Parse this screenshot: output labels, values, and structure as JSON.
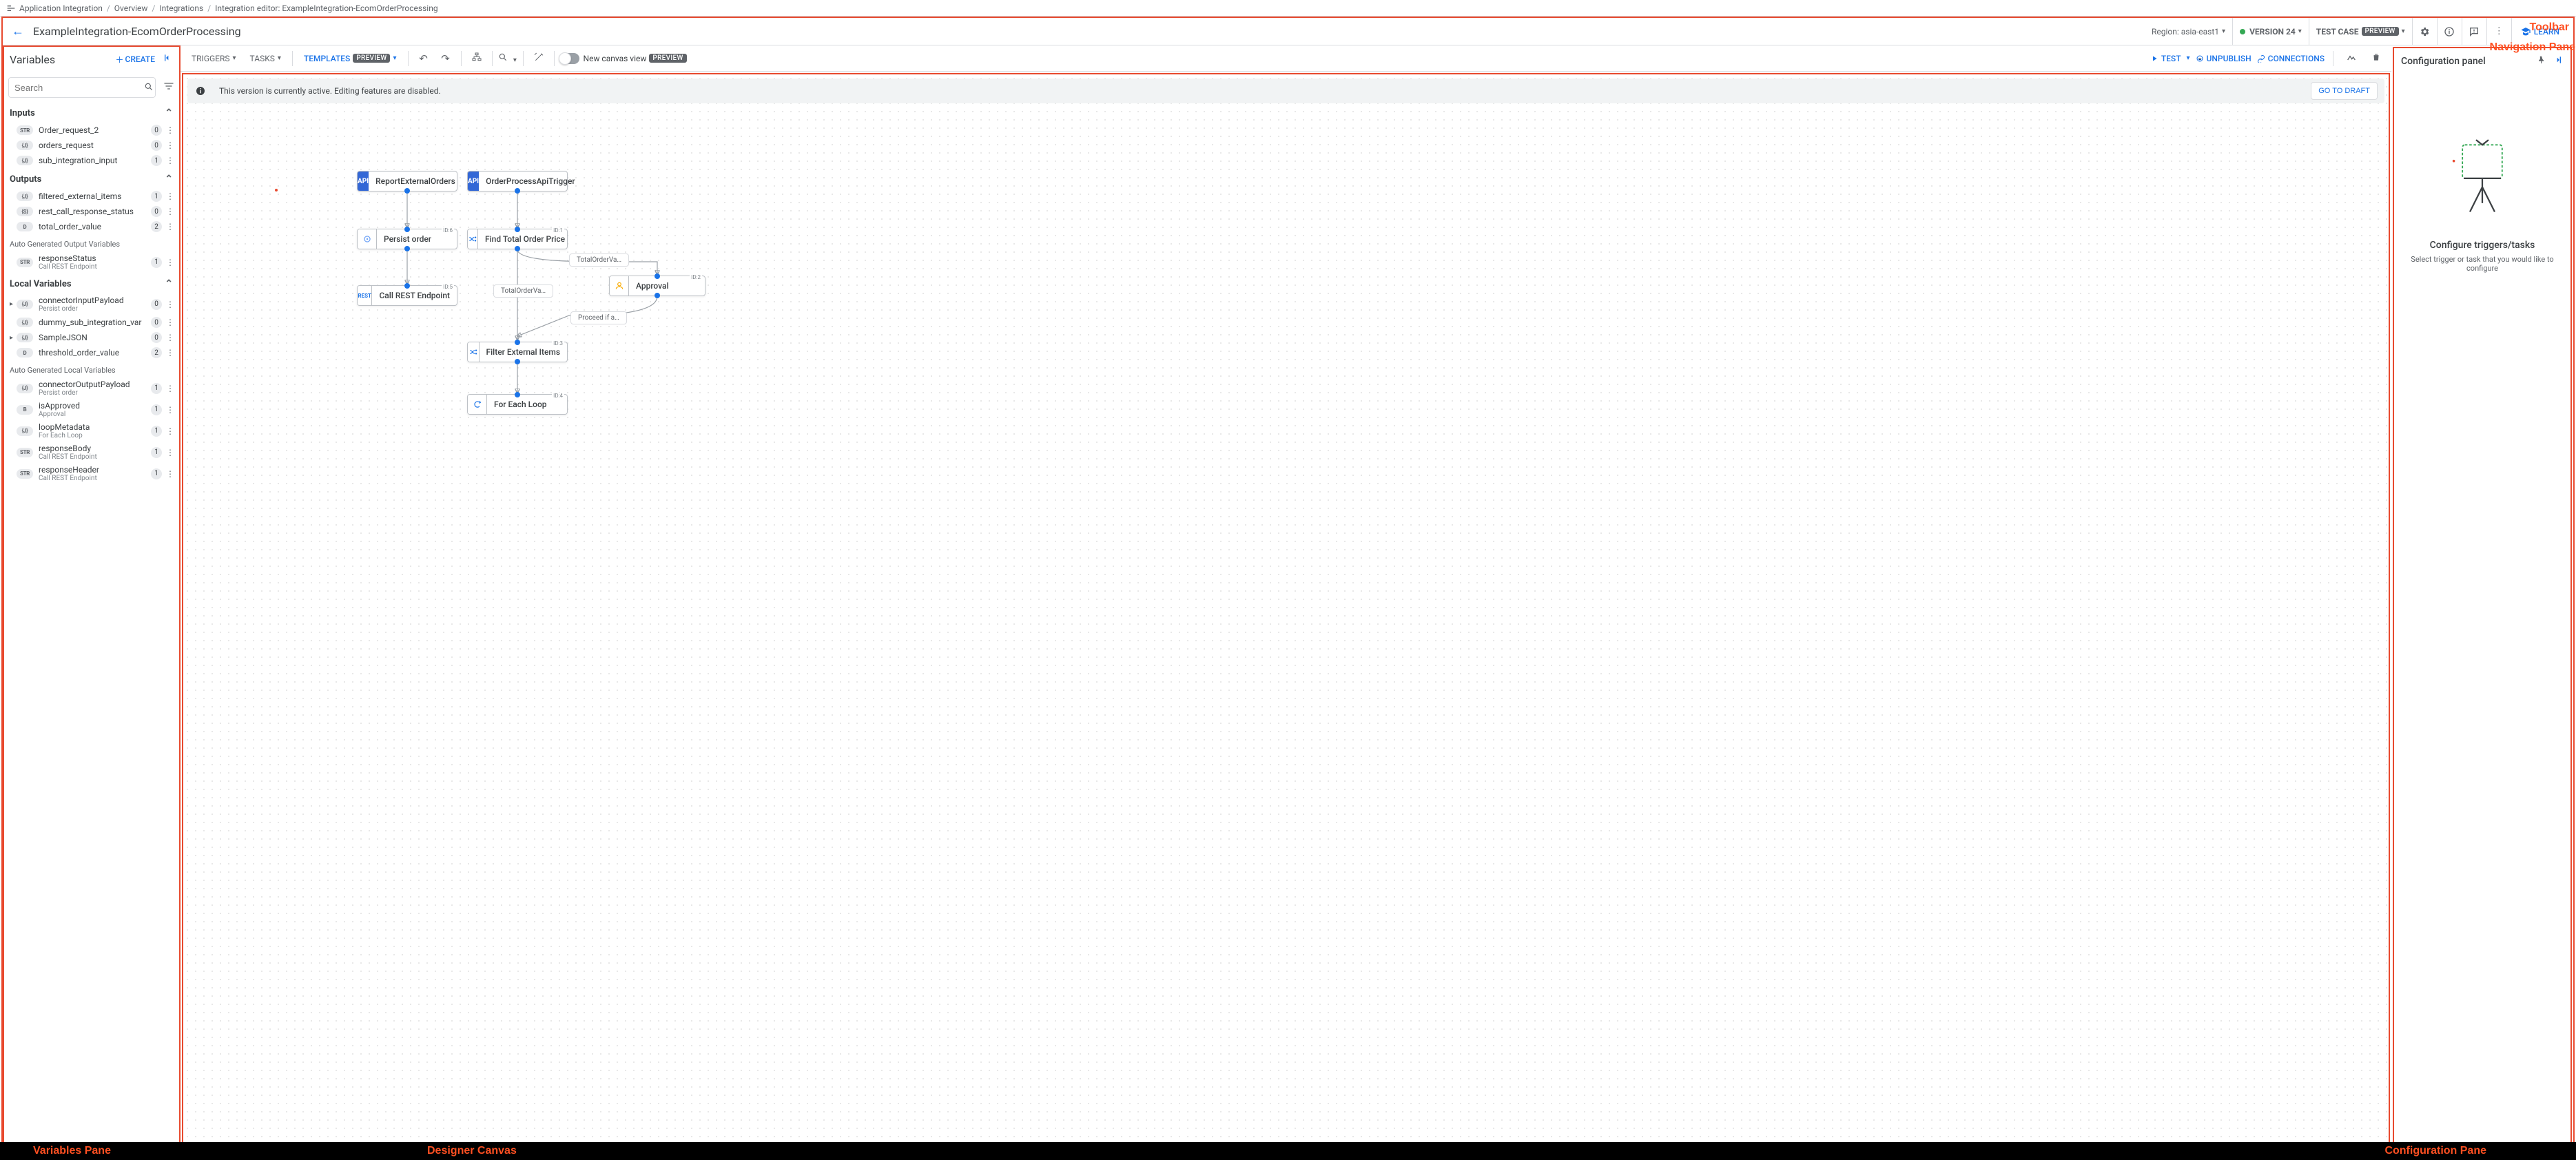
{
  "breadcrumb": {
    "items": [
      "Application Integration",
      "Overview",
      "Integrations",
      "Integration editor: ExampleIntegration-EcomOrderProcessing"
    ]
  },
  "titlebar": {
    "title": "ExampleIntegration-EcomOrderProcessing",
    "region_label": "Region:",
    "region_value": "asia-east1",
    "version_label": "VERSION 24",
    "testcase_label": "TEST CASE",
    "testcase_badge": "PREVIEW",
    "learn_label": "LEARN"
  },
  "variables_pane": {
    "title": "Variables",
    "create_label": "CREATE",
    "search_placeholder": "Search",
    "sections": {
      "inputs": {
        "label": "Inputs",
        "items": [
          {
            "type": "STR",
            "name": "Order_request_2",
            "count": "0"
          },
          {
            "type": "{J}",
            "name": "orders_request",
            "count": "0"
          },
          {
            "type": "{J}",
            "name": "sub_integration_input",
            "count": "1"
          }
        ]
      },
      "outputs": {
        "label": "Outputs",
        "items": [
          {
            "type": "{J}",
            "name": "filtered_external_items",
            "count": "1"
          },
          {
            "type": "{S}",
            "name": "rest_call_response_status",
            "count": "0"
          },
          {
            "type": "D",
            "name": "total_order_value",
            "count": "2"
          }
        ]
      },
      "auto_out": {
        "label": "Auto Generated Output Variables",
        "items": [
          {
            "type": "STR",
            "name": "responseStatus",
            "sub": "Call REST Endpoint",
            "count": "1"
          }
        ]
      },
      "local": {
        "label": "Local Variables",
        "items": [
          {
            "type": "{J}",
            "name": "connectorInputPayload",
            "sub": "Persist order",
            "count": "0",
            "expandable": true
          },
          {
            "type": "{J}",
            "name": "dummy_sub_integration_var",
            "count": "0"
          },
          {
            "type": "{J}",
            "name": "SampleJSON",
            "count": "0",
            "expandable": true
          },
          {
            "type": "D",
            "name": "threshold_order_value",
            "count": "2"
          }
        ]
      },
      "auto_local": {
        "label": "Auto Generated Local Variables",
        "items": [
          {
            "type": "{J}",
            "name": "connectorOutputPayload",
            "sub": "Persist order",
            "count": "1"
          },
          {
            "type": "B",
            "name": "isApproved",
            "sub": "Approval",
            "count": "1"
          },
          {
            "type": "{J}",
            "name": "loopMetadata",
            "sub": "For Each Loop",
            "count": "1"
          },
          {
            "type": "STR",
            "name": "responseBody",
            "sub": "Call REST Endpoint",
            "count": "1"
          },
          {
            "type": "STR",
            "name": "responseHeader",
            "sub": "Call REST Endpoint",
            "count": "1"
          }
        ]
      }
    }
  },
  "canvas_toolbar": {
    "triggers": "TRIGGERS",
    "tasks": "TASKS",
    "templates": "TEMPLATES",
    "templates_badge": "PREVIEW",
    "new_canvas": "New canvas view",
    "new_canvas_badge": "PREVIEW",
    "test": "TEST",
    "unpublish": "UNPUBLISH",
    "connections": "CONNECTIONS"
  },
  "banner": {
    "text": "This version is currently active. Editing features are disabled.",
    "draft": "GO TO DRAFT"
  },
  "nodes": {
    "t1": {
      "label": "ReportExternalOrders",
      "icon": "API"
    },
    "t2": {
      "label": "OrderProcessApiTrigger",
      "icon": "API"
    },
    "n_persist": {
      "label": "Persist order",
      "id": "ID:6"
    },
    "n_findprice": {
      "label": "Find Total Order Price",
      "id": "ID:1"
    },
    "n_rest": {
      "label": "Call REST Endpoint",
      "id": "ID:5"
    },
    "n_approval": {
      "label": "Approval",
      "id": "ID:2"
    },
    "n_filter": {
      "label": "Filter External Items",
      "id": "ID:3"
    },
    "n_loop": {
      "label": "For Each Loop",
      "id": "ID:4"
    }
  },
  "edge_labels": {
    "e1": "TotalOrderVa…",
    "e2": "TotalOrderVa…",
    "e3": "Proceed if a…"
  },
  "config_panel": {
    "title": "Configuration panel",
    "heading": "Configure triggers/tasks",
    "desc": "Select trigger or task that you would like to configure"
  },
  "annotations": {
    "toolbar": "Toolbar",
    "navpane": "Navigation Pane",
    "varpane": "Variables Pane",
    "canvas": "Designer Canvas",
    "confpane": "Configuration Pane"
  }
}
